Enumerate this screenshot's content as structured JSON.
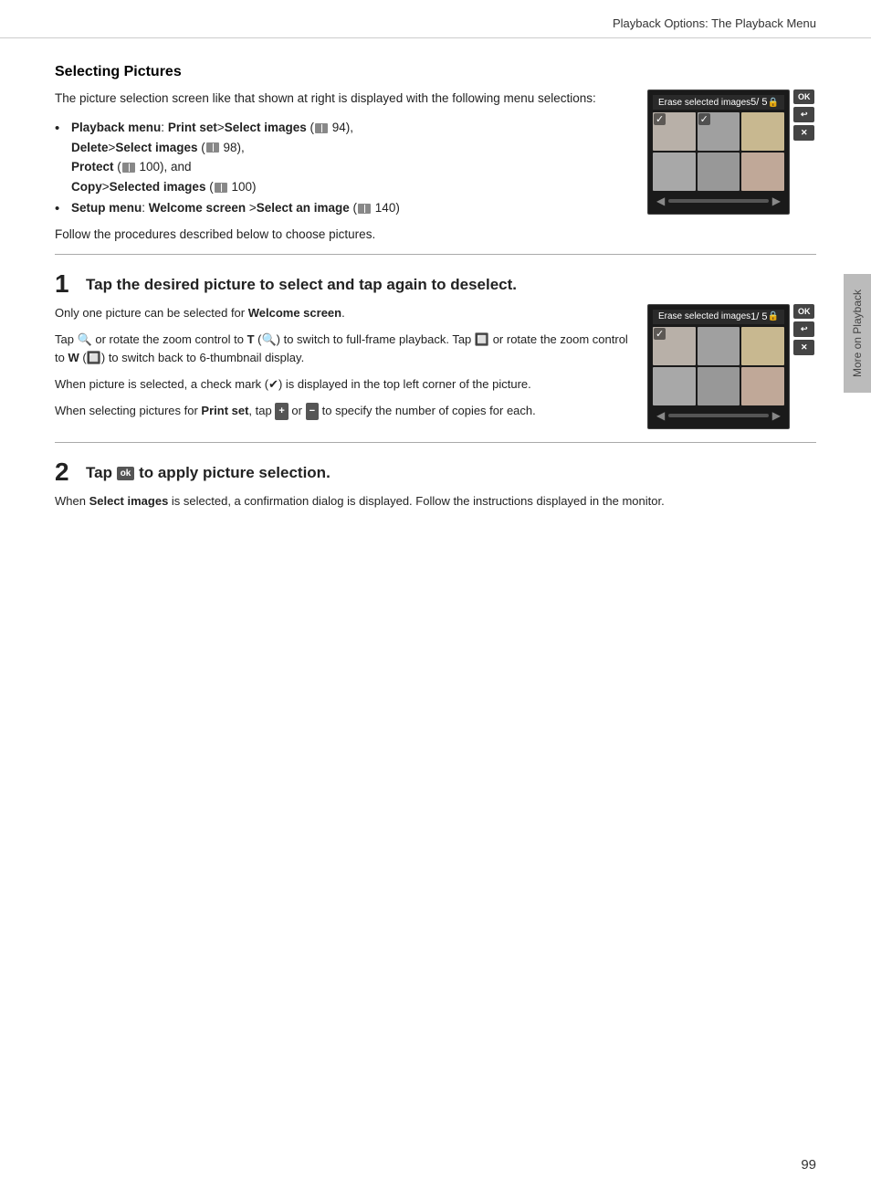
{
  "header": {
    "title": "Playback Options: The Playback Menu"
  },
  "section": {
    "title": "Selecting Pictures",
    "intro": "The picture selection screen like that shown at right is displayed with the following menu selections:",
    "bullets": [
      {
        "prefix": "Playback menu",
        "parts": [
          {
            "bold": true,
            "text": "Print set"
          },
          {
            "bold": false,
            "text": ">"
          },
          {
            "bold": true,
            "text": "Select images"
          },
          {
            "bold": false,
            "text": " ("
          },
          {
            "bold": false,
            "text": "□"
          },
          {
            "bold": false,
            "text": " 94), "
          },
          {
            "bold": true,
            "text": "Delete"
          },
          {
            "bold": false,
            "text": ">"
          },
          {
            "bold": true,
            "text": "Select images"
          },
          {
            "bold": false,
            "text": " ("
          },
          {
            "bold": false,
            "text": "□"
          },
          {
            "bold": false,
            "text": " 98),"
          },
          {
            "bold": true,
            "text": "Protect"
          },
          {
            "bold": false,
            "text": " ("
          },
          {
            "bold": false,
            "text": "□"
          },
          {
            "bold": false,
            "text": " 100), and"
          },
          {
            "bold": true,
            "text": "Copy"
          },
          {
            "bold": false,
            "text": ">"
          },
          {
            "bold": true,
            "text": "Selected images"
          },
          {
            "bold": false,
            "text": " ("
          },
          {
            "bold": false,
            "text": "□"
          },
          {
            "bold": false,
            "text": " 100)"
          }
        ],
        "full": "Playback menu: Print set > Select images (□ 94), Delete > Select images (□ 98), Protect (□ 100), and Copy > Selected images (□ 100)"
      },
      {
        "full": "Setup menu: Welcome screen > Select an image (□ 140)"
      }
    ],
    "follow_text": "Follow the procedures described below to choose pictures."
  },
  "camera_top": {
    "title": "Erase selected images",
    "counter": "5/ 5",
    "thumbnails": [
      {
        "selected": true,
        "color": "#b8b0a8"
      },
      {
        "selected": true,
        "color": "#a0a0a0"
      },
      {
        "selected": false,
        "color": "#c8b890"
      },
      {
        "selected": false,
        "color": "#a8a8a8"
      },
      {
        "selected": false,
        "color": "#989898"
      },
      {
        "selected": false,
        "color": "#c0a898"
      }
    ],
    "buttons": [
      "OK",
      "↩",
      "✕"
    ]
  },
  "steps": [
    {
      "number": "1",
      "title": "Tap the desired picture to select and tap again to deselect.",
      "paragraphs": [
        "Only one picture can be selected for <b>Welcome screen</b>.",
        "Tap 🔍 or rotate the zoom control to T (🔍) to switch to full-frame playback. Tap 🔲 or rotate the zoom control to W (🔲) to switch back to 6-thumbnail display.",
        "When picture is selected, a check mark (✔) is displayed in the top left corner of the picture.",
        "When selecting pictures for <b>Print set</b>, tap + or − to specify the number of copies for each."
      ],
      "camera": {
        "title": "Erase selected images",
        "counter": "1/ 5",
        "thumbnails": [
          {
            "selected": true,
            "color": "#b8b0a8"
          },
          {
            "selected": false,
            "color": "#a0a0a0"
          },
          {
            "selected": false,
            "color": "#c8b890"
          },
          {
            "selected": false,
            "color": "#a8a8a8"
          },
          {
            "selected": false,
            "color": "#989898"
          },
          {
            "selected": false,
            "color": "#c0a898"
          }
        ]
      }
    },
    {
      "number": "2",
      "title": "Tap OK to apply picture selection.",
      "paragraphs": [
        "When <b>Select images</b> is selected, a confirmation dialog is displayed. Follow the instructions displayed in the monitor."
      ]
    }
  ],
  "sidebar": {
    "label": "More on Playback"
  },
  "page_number": "99"
}
